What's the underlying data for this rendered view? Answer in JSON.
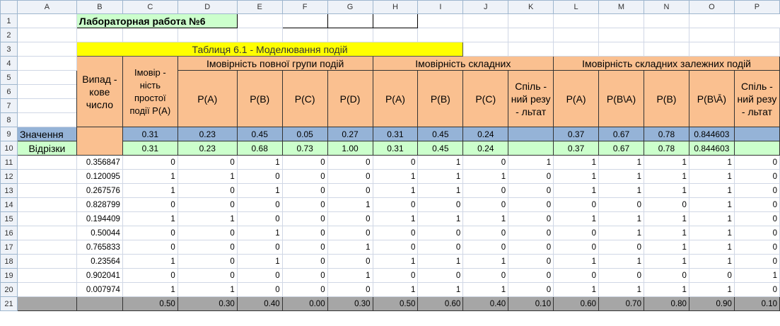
{
  "columns": [
    "A",
    "B",
    "C",
    "D",
    "E",
    "F",
    "G",
    "H",
    "I",
    "J",
    "K",
    "L",
    "M",
    "N",
    "O",
    "P"
  ],
  "row_numbers": [
    1,
    2,
    3,
    4,
    5,
    6,
    7,
    8,
    9,
    10,
    11,
    12,
    13,
    14,
    15,
    16,
    17,
    18,
    19,
    20,
    21
  ],
  "title": "Лабораторная работа №6",
  "table_caption": "Таблиця 6.1 - Моделювання подій",
  "headers": {
    "random": "Випад - кове число",
    "simple": "Імовір - ність простої події P(A)",
    "group_full": "Імовірність повної групи подій",
    "group_complex": "Імовірність складних",
    "group_dependent": "Імовірність складних залежних подій",
    "full": [
      "P(A)",
      "P(B)",
      "P(C)",
      "P(D)"
    ],
    "complex": [
      "P(A)",
      "P(B)",
      "P(C)",
      "Спіль - ний резу - льтат"
    ],
    "dependent": [
      "P(A)",
      "P(B\\A)",
      "P(B)",
      "P(B\\Ā)",
      "Спіль - ний резу - льтат"
    ]
  },
  "row9": {
    "label": "Значення",
    "values": [
      "0.31",
      "0.23",
      "0.45",
      "0.05",
      "0.27",
      "0.31",
      "0.45",
      "0.24",
      "",
      "0.37",
      "0.67",
      "0.78",
      "0.844603",
      ""
    ]
  },
  "row10": {
    "label": "Відрізки",
    "values": [
      "0.31",
      "0.23",
      "0.68",
      "0.73",
      "1.00",
      "0.31",
      "0.45",
      "0.24",
      "",
      "0.37",
      "0.67",
      "0.78",
      "0.844603",
      ""
    ]
  },
  "data_rows": [
    [
      "0.356847",
      "0",
      "0",
      "1",
      "0",
      "0",
      "0",
      "1",
      "0",
      "1",
      "1",
      "1",
      "1",
      "1",
      "0"
    ],
    [
      "0.120095",
      "1",
      "1",
      "0",
      "0",
      "0",
      "1",
      "1",
      "1",
      "0",
      "1",
      "1",
      "1",
      "1",
      "0"
    ],
    [
      "0.267576",
      "1",
      "0",
      "1",
      "0",
      "0",
      "1",
      "1",
      "0",
      "0",
      "1",
      "1",
      "1",
      "1",
      "0"
    ],
    [
      "0.828799",
      "0",
      "0",
      "0",
      "0",
      "1",
      "0",
      "0",
      "0",
      "0",
      "0",
      "0",
      "0",
      "1",
      "0"
    ],
    [
      "0.194409",
      "1",
      "1",
      "0",
      "0",
      "0",
      "1",
      "1",
      "1",
      "0",
      "1",
      "1",
      "1",
      "1",
      "0"
    ],
    [
      "0.50044",
      "0",
      "0",
      "1",
      "0",
      "0",
      "0",
      "0",
      "0",
      "0",
      "0",
      "1",
      "1",
      "1",
      "0"
    ],
    [
      "0.765833",
      "0",
      "0",
      "0",
      "0",
      "1",
      "0",
      "0",
      "0",
      "0",
      "0",
      "0",
      "1",
      "1",
      "0"
    ],
    [
      "0.23564",
      "1",
      "0",
      "1",
      "0",
      "0",
      "1",
      "1",
      "1",
      "0",
      "1",
      "1",
      "1",
      "1",
      "0"
    ],
    [
      "0.902041",
      "0",
      "0",
      "0",
      "0",
      "1",
      "0",
      "0",
      "0",
      "0",
      "0",
      "0",
      "0",
      "0",
      "1"
    ],
    [
      "0.007974",
      "1",
      "1",
      "0",
      "0",
      "0",
      "1",
      "1",
      "1",
      "0",
      "1",
      "1",
      "1",
      "1",
      "0"
    ]
  ],
  "totals": [
    "",
    "0.50",
    "0.30",
    "0.40",
    "0.00",
    "0.30",
    "0.50",
    "0.60",
    "0.40",
    "0.10",
    "0.60",
    "0.70",
    "0.80",
    "0.90",
    "0.10"
  ]
}
